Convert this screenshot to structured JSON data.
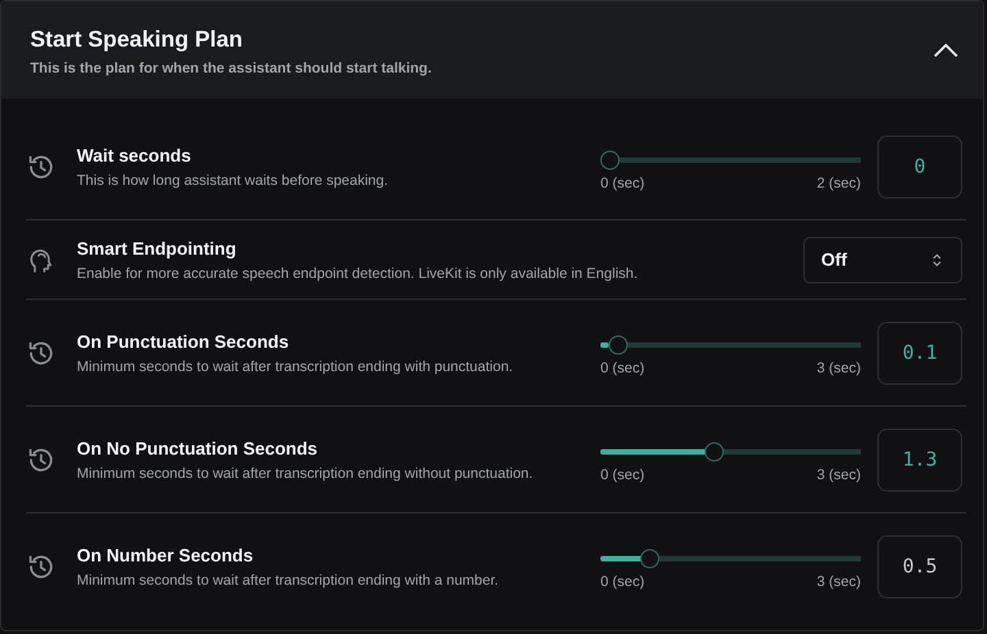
{
  "panel": {
    "title": "Start Speaking Plan",
    "subtitle": "This is the plan for when the assistant should start talking.",
    "expanded": true
  },
  "settings": [
    {
      "kind": "slider",
      "title": "Wait seconds",
      "description": "This is how long assistant waits before speaking.",
      "level": 0,
      "min_label": "0 (sec)",
      "max_label": "2 (sec)",
      "value": "0",
      "highlighted": true
    },
    {
      "kind": "select",
      "title": "Smart Endpointing",
      "description": "Enable for more accurate speech endpoint detection. LiveKit is only available in English.",
      "value": "Off"
    },
    {
      "kind": "slider",
      "title": "On Punctuation Seconds",
      "description": "Minimum seconds to wait after transcription ending with punctuation.",
      "level": 0.033,
      "min_label": "0 (sec)",
      "max_label": "3 (sec)",
      "value": "0.1",
      "highlighted": true
    },
    {
      "kind": "slider",
      "title": "On No Punctuation Seconds",
      "description": "Minimum seconds to wait after transcription ending without punctuation.",
      "level": 0.433,
      "min_label": "0 (sec)",
      "max_label": "3 (sec)",
      "value": "1.3",
      "highlighted": true
    },
    {
      "kind": "slider",
      "title": "On Number Seconds",
      "description": "Minimum seconds to wait after transcription ending with a number.",
      "level": 0.167,
      "min_label": "0 (sec)",
      "max_label": "3 (sec)",
      "value": "0.5",
      "highlighted": false
    }
  ]
}
